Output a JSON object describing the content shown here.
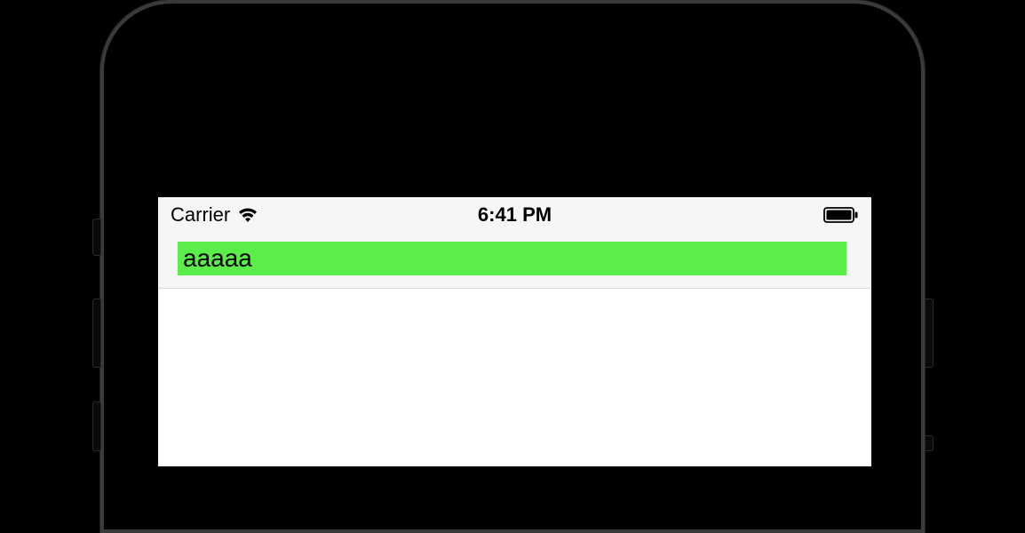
{
  "status_bar": {
    "carrier": "Carrier",
    "time": "6:41 PM"
  },
  "search": {
    "value": "aaaaa",
    "placeholder": ""
  },
  "colors": {
    "search_bg": "#5bed49"
  }
}
